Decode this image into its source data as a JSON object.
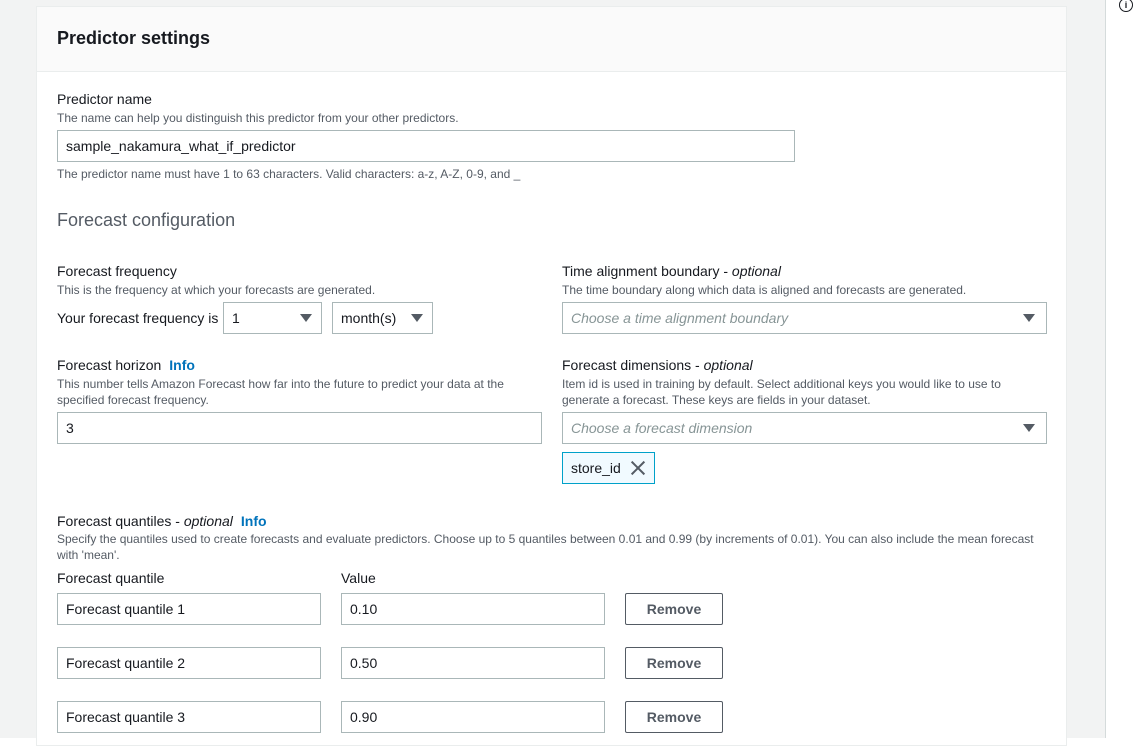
{
  "panel": {
    "title": "Predictor settings"
  },
  "predictor_name": {
    "label": "Predictor name",
    "description": "The name can help you distinguish this predictor from your other predictors.",
    "value": "sample_nakamura_what_if_predictor",
    "constraint": "The predictor name must have 1 to 63 characters. Valid characters: a-z, A-Z, 0-9, and _"
  },
  "forecast_config": {
    "title": "Forecast configuration"
  },
  "frequency": {
    "label": "Forecast frequency",
    "description": "This is the frequency at which your forecasts are generated.",
    "prefix": "Your forecast frequency is",
    "number_value": "1",
    "unit_value": "month(s)"
  },
  "time_alignment": {
    "label": "Time alignment boundary - ",
    "optional": "optional",
    "description": "The time boundary along which data is aligned and forecasts are generated.",
    "placeholder": "Choose a time alignment boundary"
  },
  "horizon": {
    "label": "Forecast horizon",
    "info": "Info",
    "description": "This number tells Amazon Forecast how far into the future to predict your data at the specified forecast frequency.",
    "value": "3"
  },
  "dimensions": {
    "label": "Forecast dimensions - ",
    "optional": "optional",
    "description": "Item id is used in training by default. Select additional keys you would like to use to generate a forecast. These keys are fields in your dataset.",
    "placeholder": "Choose a forecast dimension",
    "tokens": [
      "store_id"
    ]
  },
  "quantiles": {
    "label": "Forecast quantiles - ",
    "optional": "optional",
    "info": "Info",
    "description": "Specify the quantiles used to create forecasts and evaluate predictors. Choose up to 5 quantiles between 0.01 and 0.99 (by increments of 0.01). You can also include the mean forecast with 'mean'.",
    "col_quantile": "Forecast quantile",
    "col_value": "Value",
    "remove_label": "Remove",
    "rows": [
      {
        "name": "Forecast quantile 1",
        "value": "0.10"
      },
      {
        "name": "Forecast quantile 2",
        "value": "0.50"
      },
      {
        "name": "Forecast quantile 3",
        "value": "0.90"
      }
    ]
  },
  "icons": {
    "info": "i"
  }
}
